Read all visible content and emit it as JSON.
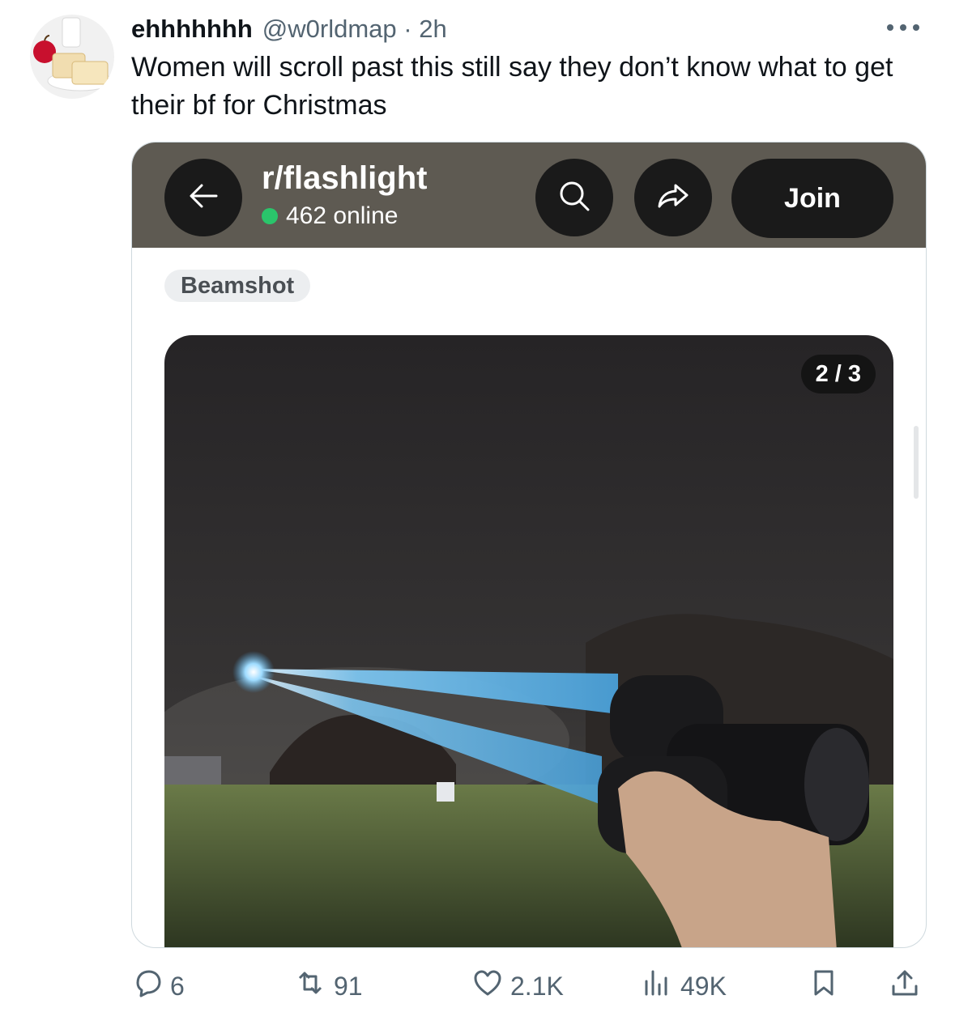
{
  "post": {
    "display_name": "ehhhhhhh",
    "handle_time": "@w0rldmap · 2h",
    "text": "Women will scroll past this still say they don’t know what to get their bf for Christmas"
  },
  "embed": {
    "subreddit": "r/flashlight",
    "online": "462 online",
    "join_label": "Join",
    "flair": "Beamshot",
    "counter": "2 / 3"
  },
  "actions": {
    "replies": "6",
    "reposts": "91",
    "likes": "2.1K",
    "views": "49K"
  },
  "icons": [
    "more-icon",
    "back-arrow-icon",
    "search-icon",
    "share-icon",
    "reply-icon",
    "repost-icon",
    "like-icon",
    "views-icon",
    "bookmark-icon",
    "upload-icon"
  ],
  "colors": {
    "topbar": "#5e5a52",
    "online_dot": "#2ac56b",
    "muted": "#536471"
  }
}
